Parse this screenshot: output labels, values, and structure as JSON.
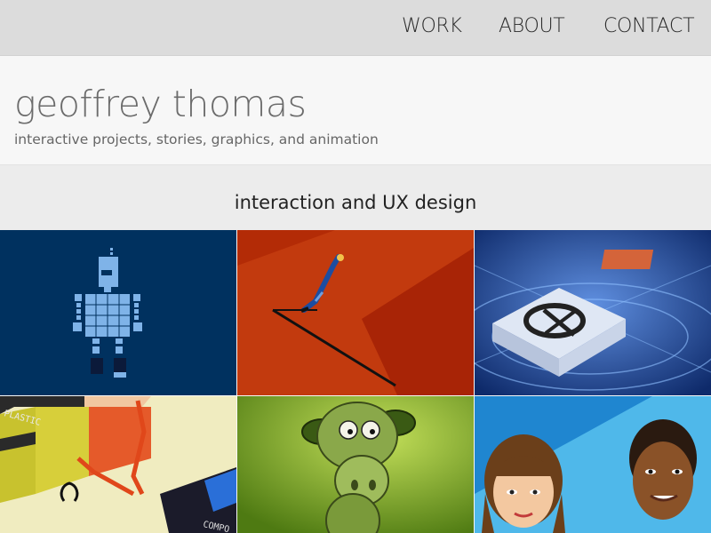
{
  "nav": {
    "work": "WORK",
    "about": "ABOUT",
    "contact": "CONTACT"
  },
  "header": {
    "title": "geoffrey thomas",
    "tagline": "interactive projects, stories, graphics, and animation"
  },
  "section": {
    "title": "interaction and UX design"
  },
  "tiles": {
    "t4_label_top": "PLASTIC",
    "t4_label_bottom": "COMPO"
  },
  "colors": {
    "nav_bg": "#dcdcdc",
    "hero_bg": "#f7f7f7",
    "section_bg": "#ececec"
  }
}
